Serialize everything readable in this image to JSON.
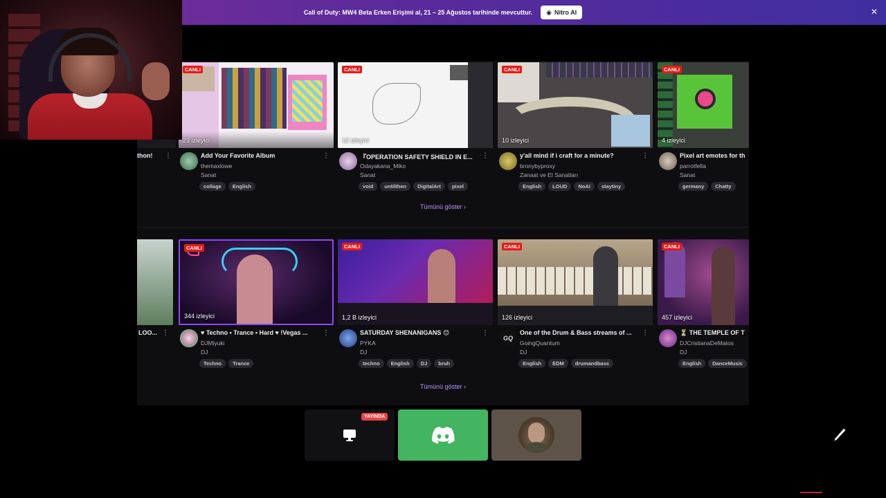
{
  "banner": {
    "text": "Call of Duty: MW4 Beta Erken Erişimi al, 21 – 25 Ağustos tarihinde mevcuttur.",
    "button_label": "Nitro Al",
    "close": "✕"
  },
  "row1": {
    "show_all": "Tümünü göster",
    "cards": [
      {
        "left_clip": "thon!"
      },
      {
        "live": "CANLI",
        "viewers": "23 izleyici",
        "title": "Add Your Favorite Album",
        "channel": "themaxlowe",
        "category": "Sanat",
        "tags": [
          "collage",
          "English"
        ]
      },
      {
        "live": "CANLI",
        "viewers": "12 izleyici",
        "title": "『OPERATION SAFETY SHIELD IN E...",
        "channel": "Odayakana_Miko",
        "category": "Sanat",
        "tags": [
          "void",
          "untilthen",
          "DigitalArt",
          "pixel"
        ]
      },
      {
        "live": "CANLI",
        "viewers": "10 izleyici",
        "title": "y'all mind if i craft for a minute?",
        "channel": "bronybyproxy",
        "category": "Zanaat ve El Sanatları",
        "tags": [
          "English",
          "LOUD",
          "NoAI",
          "staytiny"
        ]
      },
      {
        "live": "CANLI",
        "viewers": "4 izleyici",
        "title": "Pixel art emotes for th",
        "channel": "parrotfella",
        "category": "Sanat",
        "tags": [
          "germany",
          "Chatty"
        ]
      }
    ]
  },
  "row2": {
    "show_all": "Tümünü göster",
    "cards": [
      {
        "left_clip": "LOO..."
      },
      {
        "live": "CANLI",
        "viewers": "344 izleyici",
        "title": "♥ Techno • Trance • Hard ♥ !Vegas ...",
        "channel": "DJMiyuki",
        "category": "DJ",
        "tags": [
          "Techno",
          "Trance"
        ]
      },
      {
        "live": "CANLI",
        "viewers": "1,2 B izleyici",
        "title": "SATURDAY SHENANIGANS 😊",
        "channel": "PYKA",
        "category": "DJ",
        "tags": [
          "techno",
          "English",
          "DJ",
          "bruh"
        ]
      },
      {
        "live": "CANLI",
        "viewers": "126 izleyici",
        "title": "One of the Drum & Bass streams of ...",
        "channel": "GoingQuantum",
        "category": "DJ",
        "tags": [
          "English",
          "EDM",
          "drumandbass"
        ]
      },
      {
        "live": "CANLI",
        "viewers": "457 izleyici",
        "title": "⏳ THE TEMPLE OF T",
        "channel": "DJCristianaDeMatos",
        "category": "DJ",
        "tags": [
          "English",
          "DanceMusic"
        ]
      }
    ]
  },
  "tiles": {
    "live_label": "YAYINDA"
  },
  "colors": {
    "accent": "#bf94ff",
    "live": "#e91916",
    "discord": "#43b561"
  },
  "icons": [
    "close-icon",
    "eye-icon",
    "kebab-icon",
    "chevron-right-icon",
    "screen-icon",
    "discord-icon",
    "pen-icon"
  ]
}
